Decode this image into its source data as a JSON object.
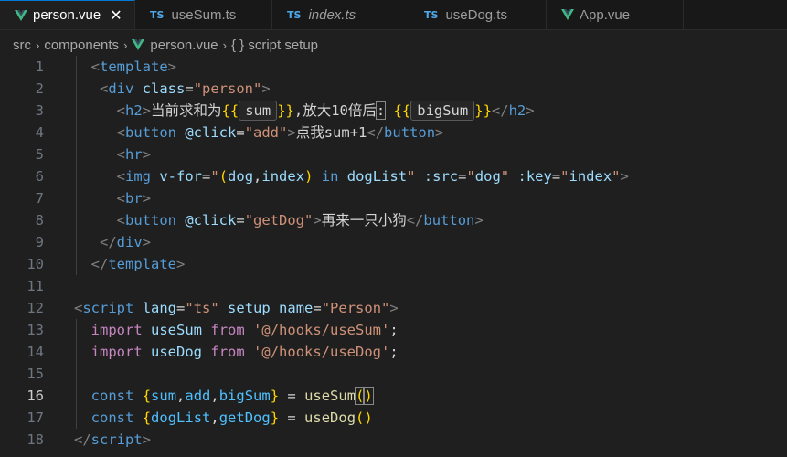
{
  "tabs": [
    {
      "icon": "vue-icon",
      "label": "person.vue",
      "active": true,
      "close": "✕"
    },
    {
      "icon": "ts-icon",
      "label": "useSum.ts"
    },
    {
      "icon": "ts-icon",
      "label": "index.ts",
      "italic": true
    },
    {
      "icon": "ts-icon",
      "label": "useDog.ts"
    },
    {
      "icon": "vue-icon",
      "label": "App.vue"
    }
  ],
  "ts_icon_text": "TS",
  "breadcrumb": {
    "items": [
      "src",
      "components",
      "person.vue",
      "{ } script setup"
    ]
  },
  "lines": [
    {
      "n": "1",
      "tokens": [
        [
          "t-br",
          "  <"
        ],
        [
          "t-tag",
          "template"
        ],
        [
          "t-br",
          ">"
        ]
      ]
    },
    {
      "n": "2",
      "tokens": [
        [
          "t-br",
          "   <"
        ],
        [
          "t-tag",
          "div"
        ],
        [
          "t-txt",
          " "
        ],
        [
          "t-attr",
          "class"
        ],
        [
          "t-txt",
          "="
        ],
        [
          "t-str",
          "\"person\""
        ],
        [
          "t-br",
          ">"
        ]
      ]
    },
    {
      "n": "3",
      "special": "h2"
    },
    {
      "n": "4",
      "tokens": [
        [
          "t-br",
          "     <"
        ],
        [
          "t-tag",
          "button"
        ],
        [
          "t-txt",
          " "
        ],
        [
          "t-attr",
          "@click"
        ],
        [
          "t-txt",
          "="
        ],
        [
          "t-str",
          "\"add\""
        ],
        [
          "t-br",
          ">"
        ],
        [
          "t-txt",
          "点我sum+1"
        ],
        [
          "t-br",
          "</"
        ],
        [
          "t-tag",
          "button"
        ],
        [
          "t-br",
          ">"
        ]
      ]
    },
    {
      "n": "5",
      "tokens": [
        [
          "t-br",
          "     <"
        ],
        [
          "t-tag",
          "hr"
        ],
        [
          "t-br",
          ">"
        ]
      ]
    },
    {
      "n": "6",
      "tokens": [
        [
          "t-br",
          "     <"
        ],
        [
          "t-tag",
          "img"
        ],
        [
          "t-txt",
          " "
        ],
        [
          "t-attr",
          "v-for"
        ],
        [
          "t-txt",
          "="
        ],
        [
          "t-str",
          "\""
        ],
        [
          "t-paren",
          "("
        ],
        [
          "t-var2",
          "dog"
        ],
        [
          "t-txt",
          ","
        ],
        [
          "t-var2",
          "index"
        ],
        [
          "t-paren",
          ")"
        ],
        [
          "t-txt",
          " "
        ],
        [
          "t-kw2",
          "in"
        ],
        [
          "t-txt",
          " "
        ],
        [
          "t-var2",
          "dogList"
        ],
        [
          "t-str",
          "\""
        ],
        [
          "t-txt",
          " "
        ],
        [
          "t-attr",
          ":src"
        ],
        [
          "t-txt",
          "="
        ],
        [
          "t-str",
          "\""
        ],
        [
          "t-var2",
          "dog"
        ],
        [
          "t-str",
          "\""
        ],
        [
          "t-txt",
          " "
        ],
        [
          "t-attr",
          ":key"
        ],
        [
          "t-txt",
          "="
        ],
        [
          "t-str",
          "\""
        ],
        [
          "t-var2",
          "index"
        ],
        [
          "t-str",
          "\""
        ],
        [
          "t-br",
          ">"
        ]
      ]
    },
    {
      "n": "7",
      "tokens": [
        [
          "t-br",
          "     <"
        ],
        [
          "t-tag",
          "br"
        ],
        [
          "t-br",
          ">"
        ]
      ]
    },
    {
      "n": "8",
      "tokens": [
        [
          "t-br",
          "     <"
        ],
        [
          "t-tag",
          "button"
        ],
        [
          "t-txt",
          " "
        ],
        [
          "t-attr",
          "@click"
        ],
        [
          "t-txt",
          "="
        ],
        [
          "t-str",
          "\"getDog\""
        ],
        [
          "t-br",
          ">"
        ],
        [
          "t-txt",
          "再来一只小狗"
        ],
        [
          "t-br",
          "</"
        ],
        [
          "t-tag",
          "button"
        ],
        [
          "t-br",
          ">"
        ]
      ]
    },
    {
      "n": "9",
      "tokens": [
        [
          "t-br",
          "   </"
        ],
        [
          "t-tag",
          "div"
        ],
        [
          "t-br",
          ">"
        ]
      ]
    },
    {
      "n": "10",
      "tokens": [
        [
          "t-br",
          "  </"
        ],
        [
          "t-tag",
          "template"
        ],
        [
          "t-br",
          ">"
        ]
      ]
    },
    {
      "n": "11",
      "tokens": []
    },
    {
      "n": "12",
      "tokens": [
        [
          "t-br",
          "<"
        ],
        [
          "t-tag",
          "script"
        ],
        [
          "t-txt",
          " "
        ],
        [
          "t-attr",
          "lang"
        ],
        [
          "t-txt",
          "="
        ],
        [
          "t-str",
          "\"ts\""
        ],
        [
          "t-txt",
          " "
        ],
        [
          "t-attr",
          "setup"
        ],
        [
          "t-txt",
          " "
        ],
        [
          "t-attr",
          "name"
        ],
        [
          "t-txt",
          "="
        ],
        [
          "t-str",
          "\"Person\""
        ],
        [
          "t-br",
          ">"
        ]
      ]
    },
    {
      "n": "13",
      "tokens": [
        [
          "t-txt",
          "  "
        ],
        [
          "t-kw",
          "import"
        ],
        [
          "t-txt",
          " "
        ],
        [
          "t-var2",
          "useSum"
        ],
        [
          "t-txt",
          " "
        ],
        [
          "t-kw",
          "from"
        ],
        [
          "t-txt",
          " "
        ],
        [
          "t-str",
          "'@/hooks/useSum'"
        ],
        [
          "t-txt",
          ";"
        ]
      ]
    },
    {
      "n": "14",
      "tokens": [
        [
          "t-txt",
          "  "
        ],
        [
          "t-kw",
          "import"
        ],
        [
          "t-txt",
          " "
        ],
        [
          "t-var2",
          "useDog"
        ],
        [
          "t-txt",
          " "
        ],
        [
          "t-kw",
          "from"
        ],
        [
          "t-txt",
          " "
        ],
        [
          "t-str",
          "'@/hooks/useDog'"
        ],
        [
          "t-txt",
          ";"
        ]
      ]
    },
    {
      "n": "15",
      "tokens": []
    },
    {
      "n": "16",
      "current": true,
      "special": "l16"
    },
    {
      "n": "17",
      "tokens": [
        [
          "t-txt",
          "  "
        ],
        [
          "t-kw2",
          "const"
        ],
        [
          "t-txt",
          " "
        ],
        [
          "t-brace",
          "{"
        ],
        [
          "t-var",
          "dogList"
        ],
        [
          "t-txt",
          ","
        ],
        [
          "t-var",
          "getDog"
        ],
        [
          "t-brace",
          "}"
        ],
        [
          "t-txt",
          " = "
        ],
        [
          "t-fn",
          "useDog"
        ],
        [
          "t-paren",
          "()"
        ]
      ]
    },
    {
      "n": "18",
      "tokens": [
        [
          "t-br",
          "</"
        ],
        [
          "t-tag",
          "script"
        ],
        [
          "t-br",
          ">"
        ]
      ]
    }
  ],
  "h2": {
    "pre": "     ",
    "text1": "当前求和为",
    "open": "{{",
    "hint1": "sum",
    "close": "}}",
    "text2": ",放大10倍后",
    "colon": ":",
    "hint2": "bigSum",
    "end": "</h2>"
  },
  "l16": {
    "indent": "  ",
    "kw": "const",
    "ob": "{",
    "vars": [
      "sum",
      "add",
      "bigSum"
    ],
    "cb": "}",
    "eq": " = ",
    "fn": "useSum",
    "paren_open": "(",
    "paren_close": ")"
  }
}
